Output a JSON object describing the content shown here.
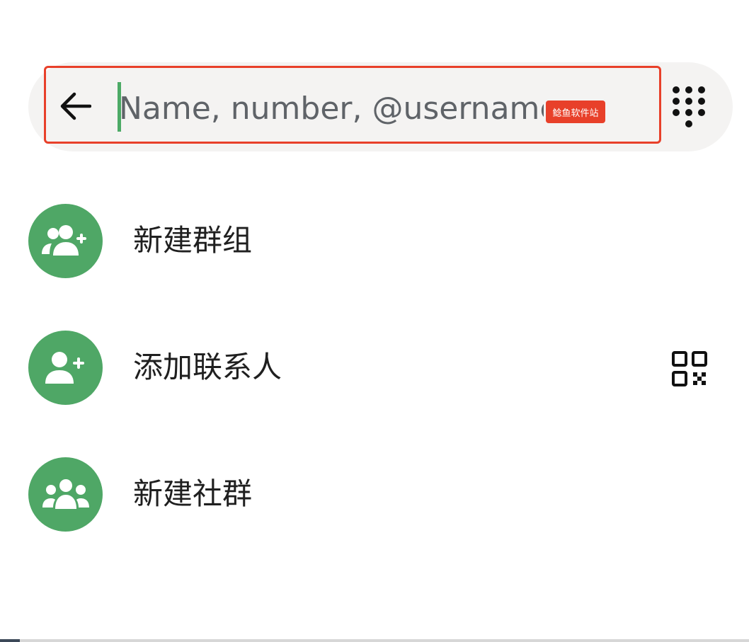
{
  "search": {
    "placeholder": "Name, number, @username",
    "value": "",
    "watermark": "鲶鱼软件站"
  },
  "icons": {
    "back": "arrow-left-icon",
    "dialpad": "dialpad-icon",
    "new_group": "add-group-icon",
    "add_contact": "add-person-icon",
    "qr": "qr-code-icon",
    "new_community": "community-icon"
  },
  "menu": {
    "items": [
      {
        "label": "新建群组"
      },
      {
        "label": "添加联系人"
      },
      {
        "label": "新建社群"
      }
    ]
  },
  "colors": {
    "accent": "#4fa766",
    "highlight": "#e8402a",
    "search_bg": "#f4f3f2"
  }
}
